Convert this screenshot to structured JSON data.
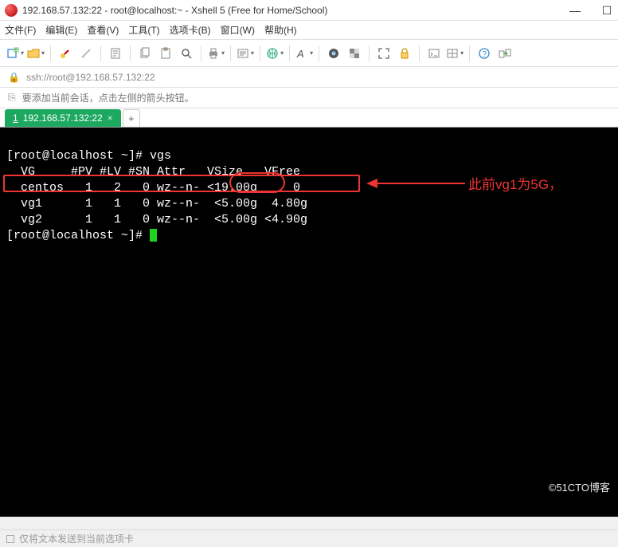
{
  "window": {
    "title": "192.168.57.132:22 - root@localhost:~ - Xshell 5 (Free for Home/School)"
  },
  "menu": {
    "file": "文件(F)",
    "edit": "编辑(E)",
    "view": "查看(V)",
    "tools": "工具(T)",
    "tabs": "选项卡(B)",
    "window": "窗口(W)",
    "help": "帮助(H)"
  },
  "address": {
    "text": "ssh://root@192.168.57.132:22"
  },
  "infobar": {
    "text": "要添加当前会话，点击左侧的箭头按钮。"
  },
  "tabs": {
    "active": {
      "index": "1",
      "label": "192.168.57.132:22"
    }
  },
  "terminal": {
    "prompt1": "[root@localhost ~]# ",
    "cmd1": "vgs",
    "header": "  VG     #PV #LV #SN Attr   VSize   VFree",
    "rows": [
      "  centos   1   2   0 wz--n- <19.00g     0",
      "  vg1      1   1   0 wz--n-  <5.00g  4.80g",
      "  vg2      1   1   0 wz--n-  <5.00g <4.90g"
    ],
    "prompt2": "[root@localhost ~]# ",
    "annotation": "此前vg1为5G，"
  },
  "statusbar": {
    "text": "仅将文本发送到当前选项卡"
  },
  "watermark": "©51CTO博客"
}
